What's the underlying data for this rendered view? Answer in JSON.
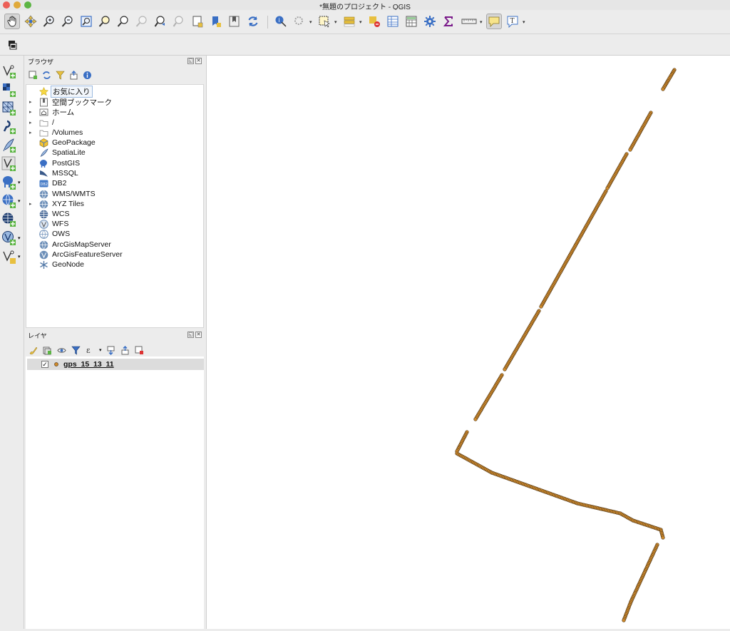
{
  "window": {
    "title": "*無題のプロジェクト - QGIS"
  },
  "browser_panel": {
    "title": "ブラウザ",
    "items": [
      {
        "label": "お気に入り",
        "icon": "star-icon",
        "expand": false,
        "selected": true
      },
      {
        "label": "空間ブックマーク",
        "icon": "bookmark-icon",
        "expand": true
      },
      {
        "label": "ホーム",
        "icon": "home-folder-icon",
        "expand": true
      },
      {
        "label": "/",
        "icon": "folder-icon",
        "expand": true
      },
      {
        "label": "/Volumes",
        "icon": "folder-icon",
        "expand": true
      },
      {
        "label": "GeoPackage",
        "icon": "geopackage-icon",
        "expand": false
      },
      {
        "label": "SpatiaLite",
        "icon": "spatialite-icon",
        "expand": false
      },
      {
        "label": "PostGIS",
        "icon": "postgis-elephant-icon",
        "expand": false
      },
      {
        "label": "MSSQL",
        "icon": "mssql-icon",
        "expand": false
      },
      {
        "label": "DB2",
        "icon": "db2-icon",
        "expand": false
      },
      {
        "label": "WMS/WMTS",
        "icon": "globe-icon",
        "expand": false
      },
      {
        "label": "XYZ Tiles",
        "icon": "globe-icon",
        "expand": true
      },
      {
        "label": "WCS",
        "icon": "globe-icon",
        "expand": false
      },
      {
        "label": "WFS",
        "icon": "wfs-icon",
        "expand": false
      },
      {
        "label": "OWS",
        "icon": "globe-outline-icon",
        "expand": false
      },
      {
        "label": "ArcGisMapServer",
        "icon": "arcgis-globe-icon",
        "expand": false
      },
      {
        "label": "ArcGisFeatureServer",
        "icon": "arcgis-globe-icon",
        "expand": false
      },
      {
        "label": "GeoNode",
        "icon": "geonode-icon",
        "expand": false
      }
    ]
  },
  "layers_panel": {
    "title": "レイヤ",
    "layers": [
      {
        "label": "gps_15_13_11",
        "checked": true,
        "check_mark": "✓"
      }
    ]
  },
  "toolbar": {
    "dropdown_arrow": "▾",
    "dock_close": "✕",
    "dock_float": "◱"
  },
  "colors": {
    "track_fill": "#d08a2a",
    "track_stroke": "#5a4020",
    "accent": "#3a6fc4"
  }
}
